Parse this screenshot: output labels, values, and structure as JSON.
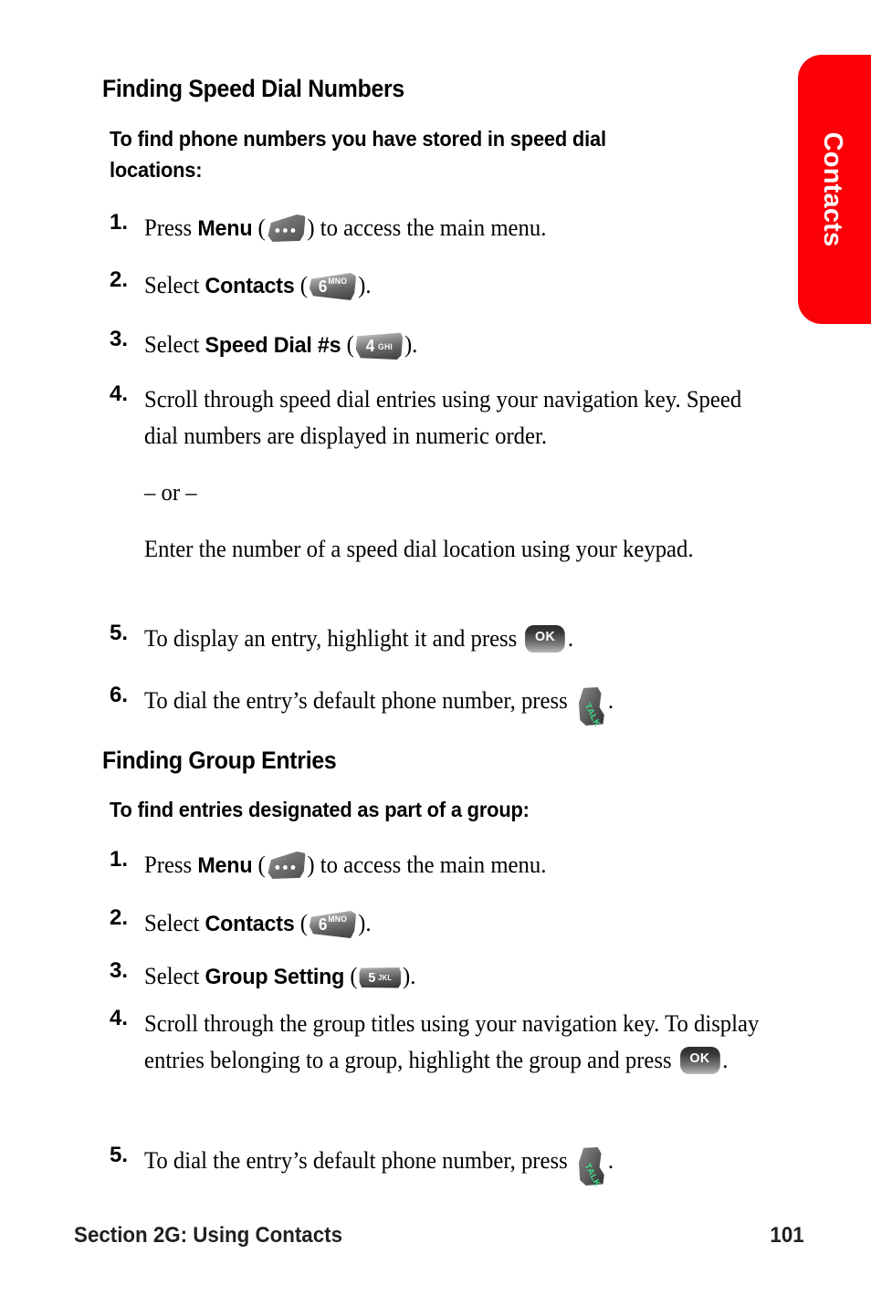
{
  "side_tab": {
    "label": "Contacts",
    "color": "#FB0007"
  },
  "sections": [
    {
      "heading": "Finding Speed Dial Numbers",
      "intro": "To find phone numbers you have stored in speed dial locations:",
      "steps": [
        {
          "num": "1.",
          "pre": "Press ",
          "ui_label": "Menu",
          "mid": " (",
          "icon": "menu-softkey",
          "post": ") to access the main menu."
        },
        {
          "num": "2.",
          "pre": "Select ",
          "ui_label": "Contacts",
          "mid": " (",
          "icon": "key-6-mno",
          "post": ")."
        },
        {
          "num": "3.",
          "pre": "Select ",
          "ui_label": "Speed Dial #s",
          "mid": " (",
          "icon": "key-4-ghi",
          "post": ")."
        },
        {
          "num": "4.",
          "pre": "Scroll through speed dial entries using your navigation key. Speed dial numbers are displayed in numeric order.",
          "or_text": "– or –",
          "extra": "Enter the number of a speed dial location using your keypad."
        },
        {
          "num": "5.",
          "pre": "To display an entry, highlight it and press ",
          "icon": "key-ok",
          "post": "."
        },
        {
          "num": "6.",
          "pre": "To dial the entry’s default phone number, press ",
          "icon": "key-talk",
          "post": "."
        }
      ]
    },
    {
      "heading": "Finding Group Entries",
      "intro": "To find entries designated as part of a group:",
      "steps": [
        {
          "num": "1.",
          "pre": "Press ",
          "ui_label": "Menu",
          "mid": " (",
          "icon": "menu-softkey",
          "post": ") to access the main menu."
        },
        {
          "num": "2.",
          "pre": "Select ",
          "ui_label": "Contacts",
          "mid": " (",
          "icon": "key-6-mno",
          "post": ")."
        },
        {
          "num": "3.",
          "pre": "Select ",
          "ui_label": "Group Setting",
          "mid": " (",
          "icon": "key-5-jkl",
          "post": ")."
        },
        {
          "num": "4.",
          "pre": "Scroll through the group titles using your navigation key. To display entries belonging to a group, highlight the group and press ",
          "icon": "key-ok",
          "post": "."
        },
        {
          "num": "5.",
          "pre": "To dial the entry’s default phone number, press ",
          "icon": "key-talk",
          "post": "."
        }
      ]
    }
  ],
  "keys": {
    "menu_dots": "•••",
    "key6": {
      "digit": "6",
      "letters": "MNO"
    },
    "key4": {
      "digit": "4",
      "letters": "GHI"
    },
    "key5": {
      "digit": "5",
      "letters": "JKL"
    },
    "ok": "OK",
    "talk": "TALK"
  },
  "footer": {
    "left": "Section 2G: Using Contacts",
    "right": "101"
  }
}
